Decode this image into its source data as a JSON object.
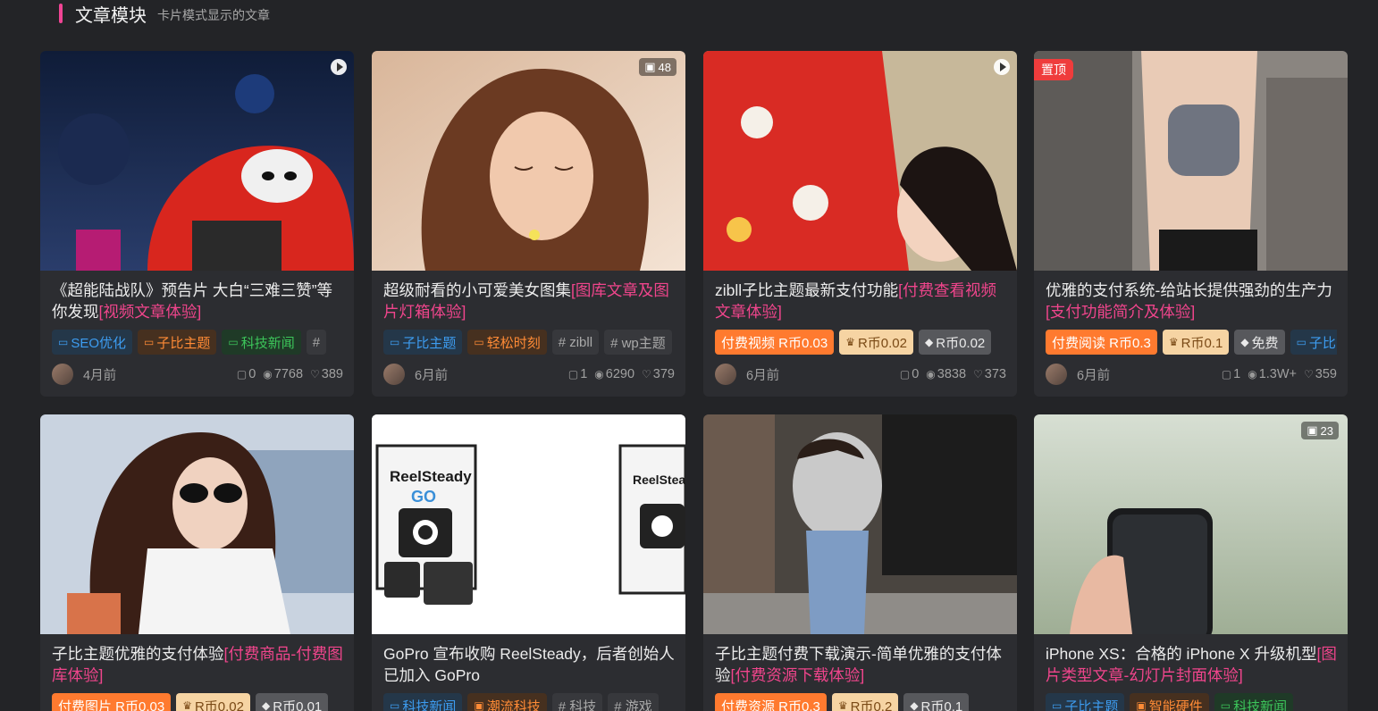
{
  "section": {
    "title": "文章模块",
    "subtitle": "卡片模式显示的文章"
  },
  "cards": [
    {
      "title": "《超能陆战队》预告片 大白“三难三赞”等你发现",
      "highlight": "[视频文章体验]",
      "badge": "play",
      "time": "4月前",
      "comments": "0",
      "views": "7768",
      "likes": "389",
      "tags": [
        "SEO优化",
        "子比主题",
        "科技新闻",
        "#"
      ]
    },
    {
      "title": "超级耐看的小可爱美女图集",
      "highlight": "[图库文章及图片灯箱体验]",
      "badge_text": "48",
      "time": "6月前",
      "comments": "1",
      "views": "6290",
      "likes": "379",
      "tags": [
        "子比主题",
        "轻松时刻",
        "# zibll",
        "# wp主题"
      ]
    },
    {
      "title": "zibll子比主题最新支付功能",
      "highlight": "[付费查看视频文章体验]",
      "badge": "play",
      "time": "6月前",
      "comments": "0",
      "views": "3838",
      "likes": "373",
      "tags": [
        "付费视频 R币0.03",
        "R币0.02",
        "R币0.02"
      ]
    },
    {
      "title": "优雅的支付系统-给站长提供强劲的生产力",
      "highlight": "[支付功能简介及体验]",
      "pin": "置顶",
      "time": "6月前",
      "comments": "1",
      "views": "1.3W+",
      "likes": "359",
      "tags": [
        "付费阅读 R币0.3",
        "R币0.1",
        "免费",
        "子比"
      ]
    },
    {
      "title": "子比主题优雅的支付体验",
      "highlight": "[付费商品-付费图库体验]",
      "tags": [
        "付费图片 R币0.03",
        "R币0.02",
        "R币0.01"
      ]
    },
    {
      "title": "GoPro 宣布收购 ReelSteady，后者创始人已加入 GoPro",
      "highlight": "",
      "tags": [
        "科技新闻",
        "潮流科技",
        "# 科技",
        "# 游戏"
      ],
      "product_a": "ReelSteady",
      "product_a_sub": "GO",
      "product_b": "ReelStea"
    },
    {
      "title": "子比主题付费下载演示-简单优雅的支付体验",
      "highlight": "[付费资源下载体验]",
      "tags": [
        "付费资源 R币0.3",
        "R币0.2",
        "R币0.1"
      ]
    },
    {
      "title": "iPhone XS：合格的 iPhone X 升级机型",
      "highlight": "[图片类型文章-幻灯片封面体验]",
      "badge_text": "23",
      "tags": [
        "子比主题",
        "智能硬件",
        "科技新闻"
      ]
    }
  ],
  "colors": {
    "accent": "#f0458c",
    "background": "#232427",
    "card": "#2c2d31"
  },
  "icons": [
    "folder-icon",
    "comment-icon",
    "eye-icon",
    "thumb-up-icon",
    "image-icon",
    "play-icon",
    "crown-icon",
    "diamond-icon"
  ]
}
